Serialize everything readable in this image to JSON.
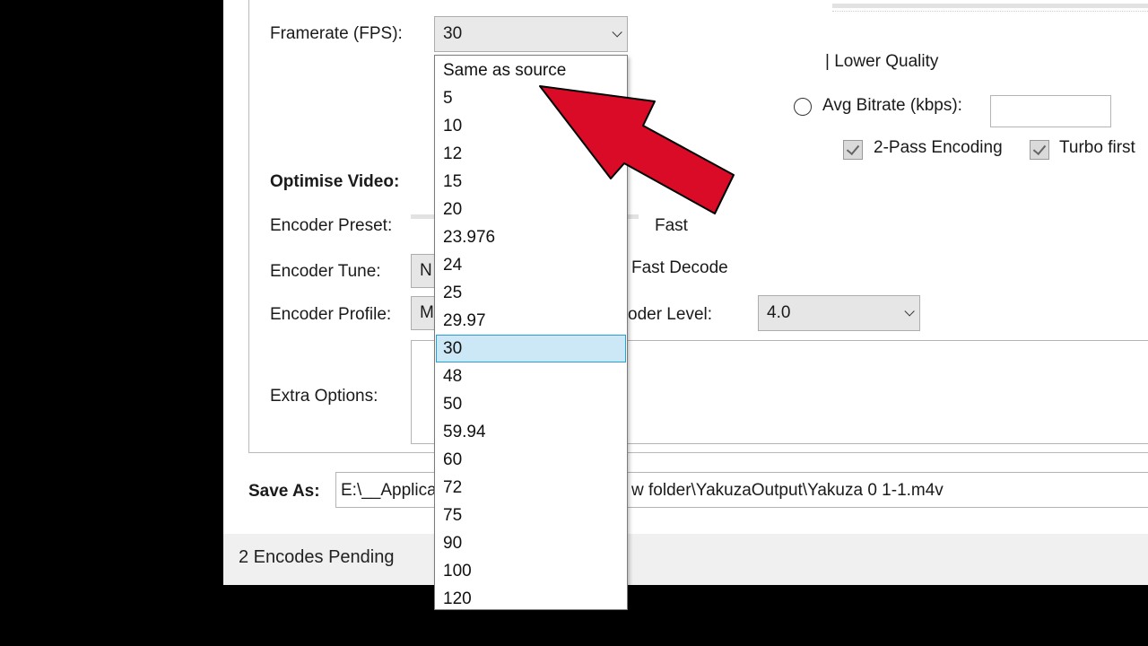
{
  "status_bar": {
    "text": "2 Encodes Pending"
  },
  "video": {
    "framerate_label": "Framerate (FPS):",
    "framerate_value": "30",
    "optimise_heading": "Optimise Video:",
    "encoder_preset_label": "Encoder Preset:",
    "encoder_preset_value": "Fast",
    "encoder_tune_label": "Encoder Tune:",
    "encoder_tune_value_partial": "N",
    "fast_decode_label": "Fast Decode",
    "encoder_profile_label": "Encoder Profile:",
    "encoder_profile_value_partial": "M",
    "encoder_level_label_partial": "oder Level:",
    "encoder_level_value": "4.0",
    "extra_options_label": "Extra Options:"
  },
  "quality": {
    "lower_quality_label": "| Lower Quality",
    "avg_bitrate_label": "Avg Bitrate (kbps):",
    "two_pass_label": "2-Pass Encoding",
    "two_pass_checked": true,
    "turbo_label": "Turbo first",
    "turbo_checked": true
  },
  "save_as": {
    "label": "Save As:",
    "path_start": "E:\\__Applica",
    "path_end": "w folder\\YakuzaOutput\\Yakuza 0 1-1.m4v"
  },
  "framerate_dropdown": {
    "selected": "30",
    "options": [
      "Same as source",
      "5",
      "10",
      "12",
      "15",
      "20",
      "23.976",
      "24",
      "25",
      "29.97",
      "30",
      "48",
      "50",
      "59.94",
      "60",
      "72",
      "75",
      "90",
      "100",
      "120"
    ]
  },
  "annotation": {
    "arrow_color": "#d90b26"
  }
}
